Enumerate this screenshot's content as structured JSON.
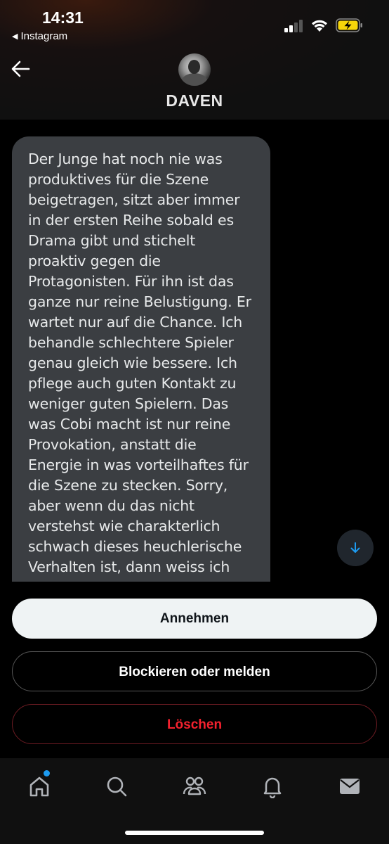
{
  "status_bar": {
    "time": "14:31",
    "back_app_label": "Instagram"
  },
  "header": {
    "contact_name": "DAVEN"
  },
  "message": {
    "text": "Der Junge hat noch nie was\nproduktives für die Szene\nbeigetragen, sitzt aber immer\nin der ersten Reihe sobald es\nDrama gibt und stichelt\nproaktiv gegen die\nProtagonisten. Für ihn ist das\nganze nur reine Belustigung. Er\nwartet nur auf die Chance. Ich\nbehandle schlechtere Spieler\ngenau gleich wie bessere. Ich\npflege auch guten Kontakt zu\nweniger guten Spielern. Das\nwas Cobi macht ist nur reine\nProvokation, anstatt die\nEnergie in was vorteilhaftes für\ndie Szene zu stecken. Sorry,\naber wenn du das nicht\nverstehst wie charakterlich\nschwach dieses heuchlerische\nVerhalten ist, dann weiss ich"
  },
  "actions": {
    "accept_label": "Annehmen",
    "block_label": "Blockieren oder melden",
    "delete_label": "Löschen"
  },
  "icons": {
    "scroll_down": "arrow-down-icon",
    "tabs": [
      "home-icon",
      "search-icon",
      "communities-icon",
      "notifications-icon",
      "messages-icon"
    ]
  },
  "colors": {
    "accent": "#1d9bf0",
    "danger": "#f4212e",
    "bubble": "#3b3e42",
    "battery_charge": "#f5d50a"
  }
}
